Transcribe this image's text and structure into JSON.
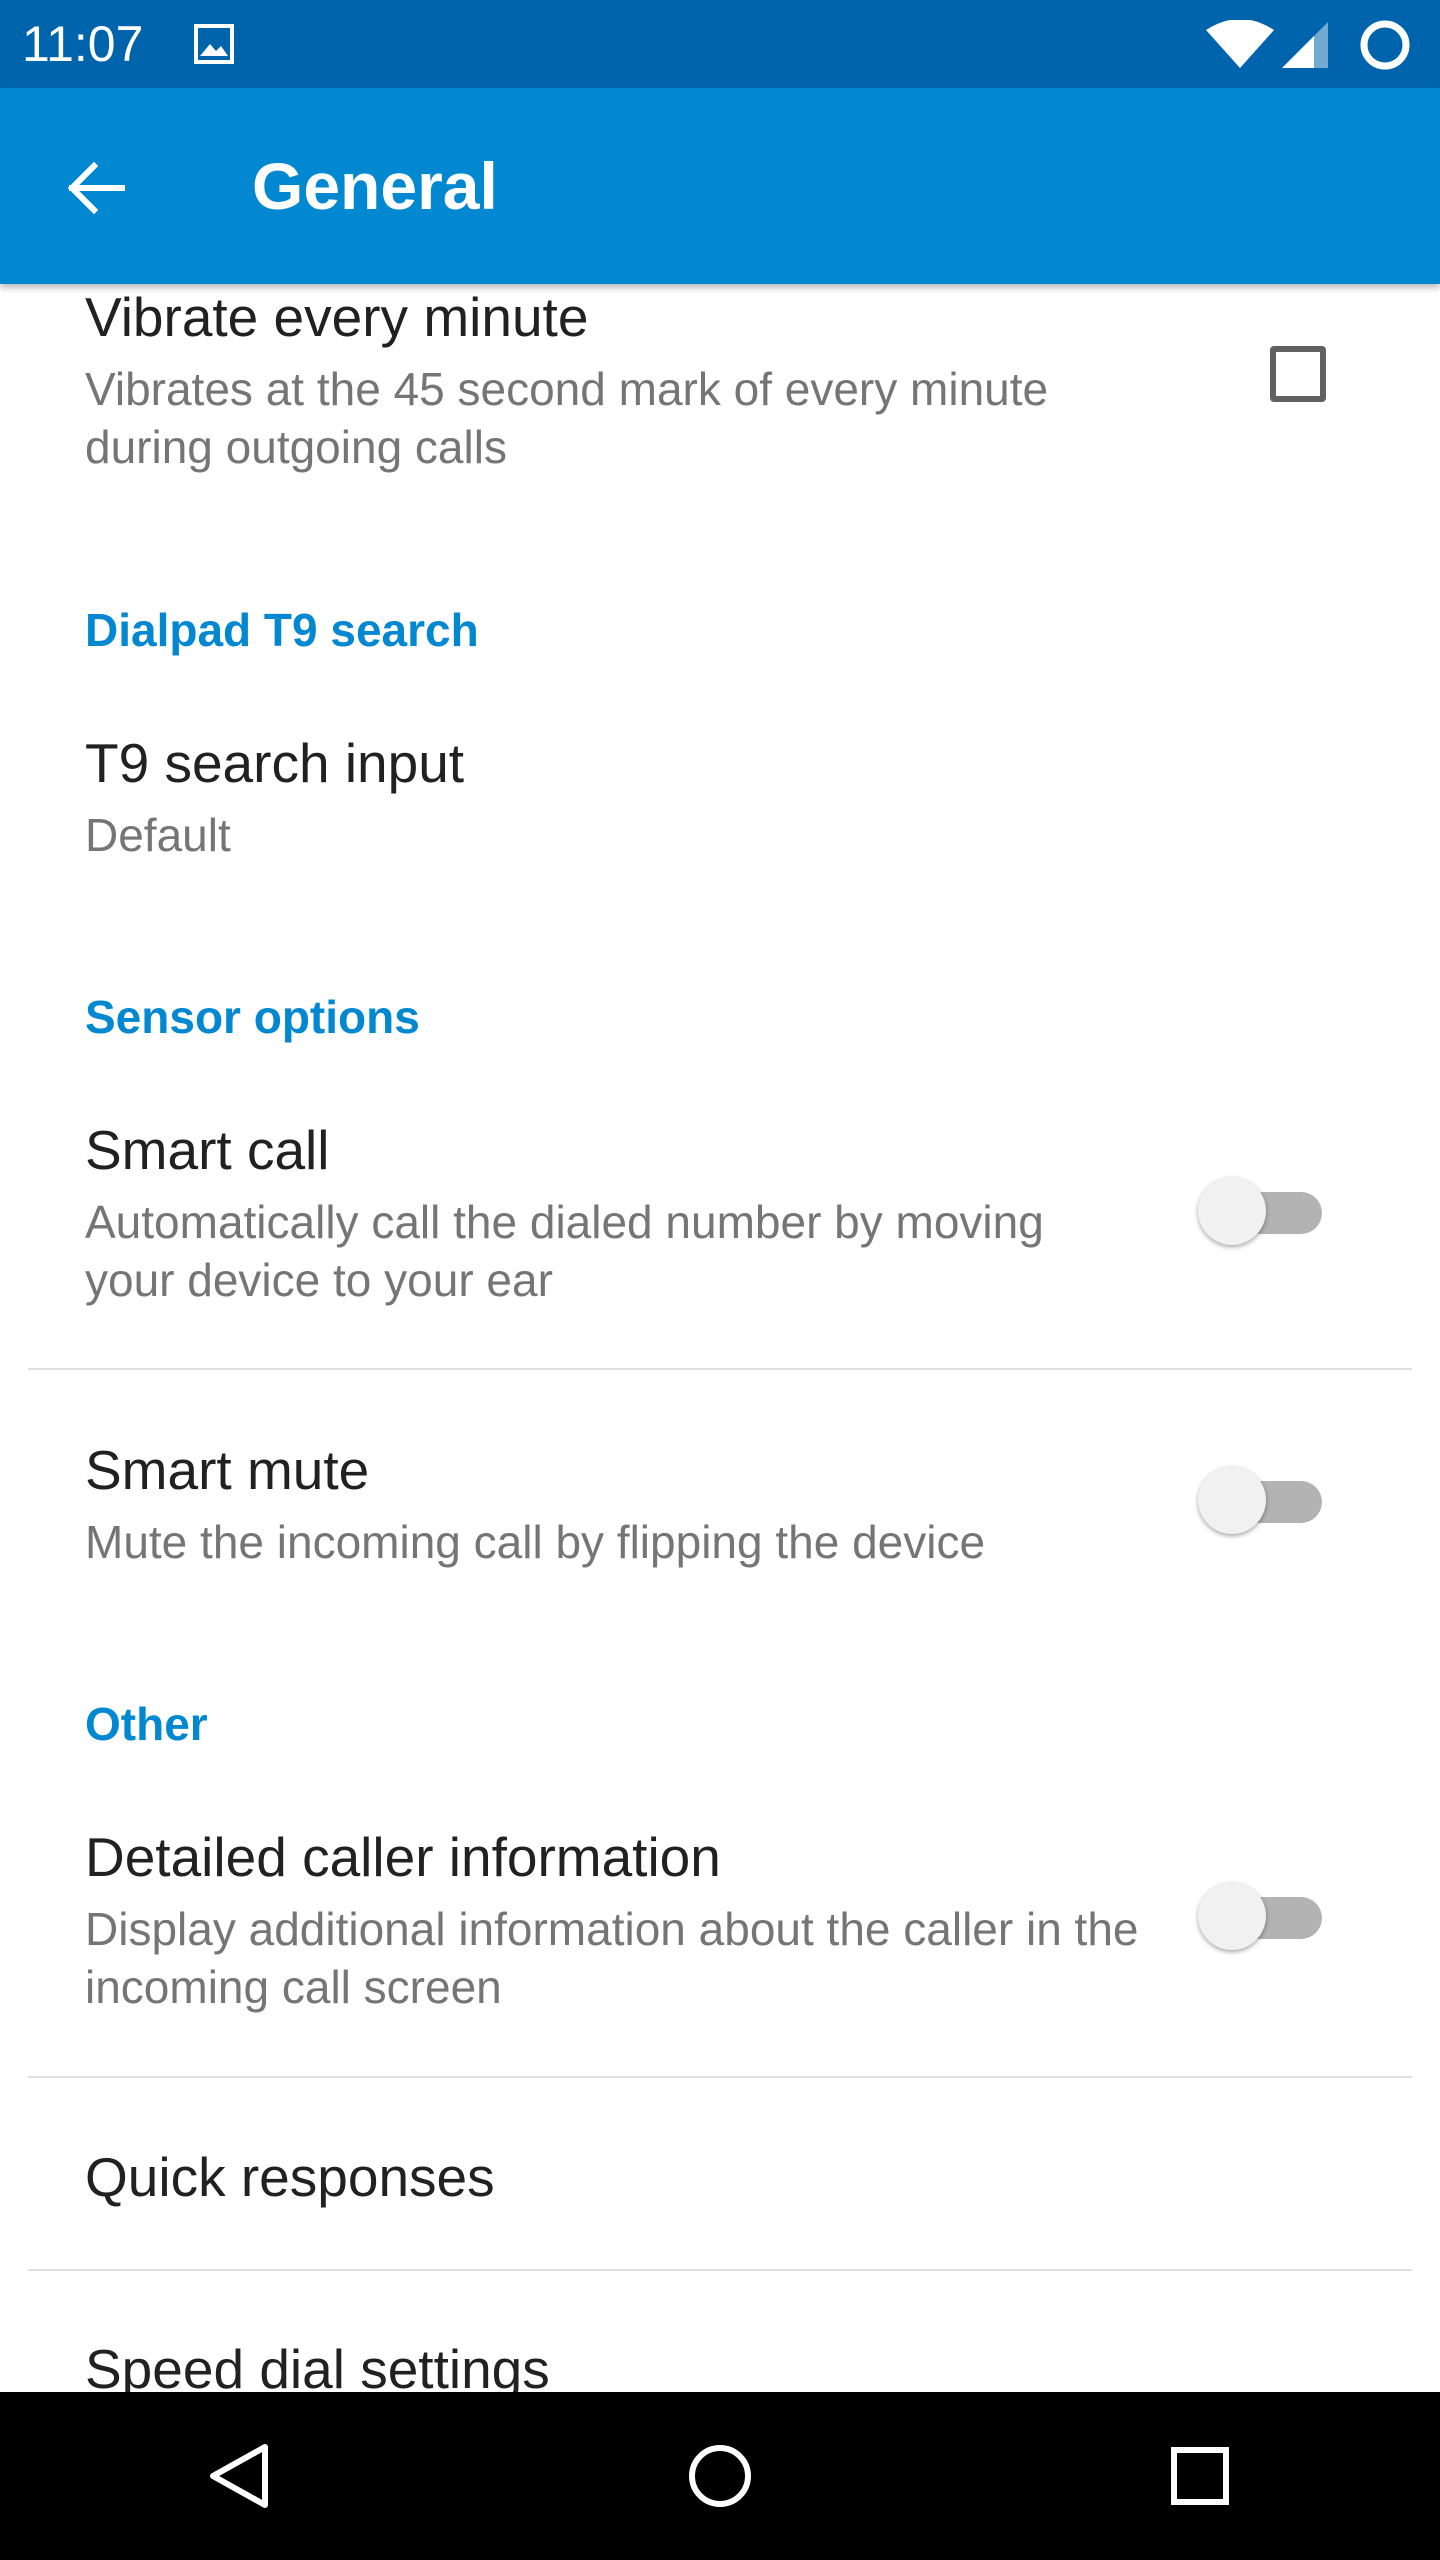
{
  "status_bar": {
    "time": "11:07",
    "icons": [
      "gallery-icon",
      "wifi-icon",
      "signal-icon",
      "battery-icon"
    ],
    "color": "#0064ad"
  },
  "app_bar": {
    "title": "General",
    "back_icon": "arrow-back-icon",
    "color": "#0288d1"
  },
  "settings": {
    "vibrate_every_minute": {
      "title": "Vibrate every minute",
      "summary": "Vibrates at the 45 second mark of every minute during outgoing calls",
      "checked": false
    },
    "section_dialpad": "Dialpad T9 search",
    "t9_search_input": {
      "title": "T9 search input",
      "summary": "Default"
    },
    "section_sensor": "Sensor options",
    "smart_call": {
      "title": "Smart call",
      "summary": "Automatically call the dialed number by moving your device to your ear",
      "enabled": false
    },
    "smart_mute": {
      "title": "Smart mute",
      "summary": "Mute the incoming call by flipping the device",
      "enabled": false
    },
    "section_other": "Other",
    "detailed_caller_info": {
      "title": "Detailed caller information",
      "summary": "Display additional information about the caller in the incoming call screen",
      "enabled": false
    },
    "quick_responses": {
      "title": "Quick responses"
    },
    "speed_dial_settings": {
      "title": "Speed dial settings"
    }
  },
  "nav_bar": {
    "buttons": [
      "back-triangle-icon",
      "home-circle-icon",
      "recents-square-icon"
    ]
  },
  "colors": {
    "accent": "#0288d1",
    "primary_text": "#212121",
    "secondary_text": "#757575"
  }
}
